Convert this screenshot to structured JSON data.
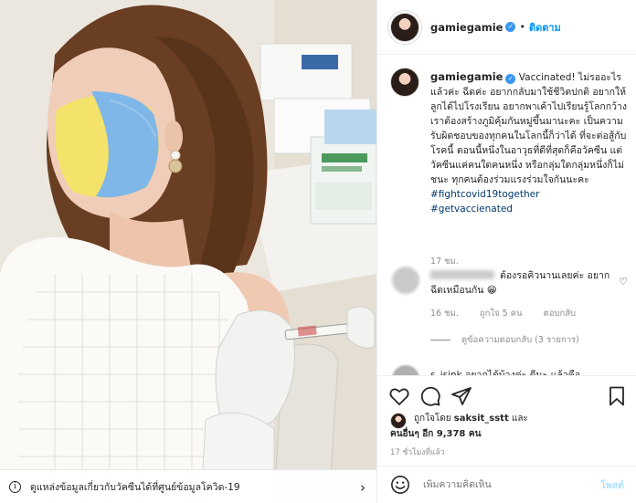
{
  "photo": {
    "info_text": "ดูแหล่งข้อมูลเกี่ยวกับวัคซีนได้ที่ศูนย์ข้อมูลโควิด-19"
  },
  "header": {
    "username": "gamiegamie",
    "follow_label": "ติดตาม"
  },
  "caption": {
    "username": "gamiegamie",
    "text": "Vaccinated! ไม่รออะไรแล้วค่ะ ฉีดค่ะ อยากกลับมาใช้ชีวิตปกติ อยากให้ลูกได้ไปโรงเรียน อยากพาเค้าไปเรียนรู้โลกกว้าง เราต้องสร้างภูมิคุ้มกันหมู่ขึ้นมานะคะ เป็นความรับผิดชอบของทุกคนในโลกนี้ก็ว่าได้ ที่จะต่อสู้กับโรคนี้ ตอนนี้หนึ่งในอาวุธที่ดีที่สุดก็คือวัคซีน แต่วัคซีนแค่คนใดคนหนึ่ง หรือกลุ่มใดกลุ่มหนึ่งก็ไม่ชนะ ทุกคนต้องร่วมแรงร่วมใจกันนะคะ",
    "hashtags": [
      "#fightcovid19together",
      "#getvaccienated"
    ],
    "time": "17 ชม."
  },
  "reply": {
    "text": "ต้องรอคิวนานเลยค่ะ อยากฉีดเหมือนกัน 😁",
    "time": "16 ชม.",
    "likes": "ถูกใจ 5 คน",
    "reply_label": "ตอบกลับ",
    "view_replies": "ดูข้อความตอบกลับ (3 รายการ)"
  },
  "next_comment": {
    "text": "s_isink อยากได้บ้างค่ะ ดีนะ แล้วคือ"
  },
  "likes": {
    "line1_prefix": "ถูกใจโดย",
    "line1_user": "saksit_sstt",
    "line1_suffix": "และ",
    "line2": "คนอื่นๆ อีก 9,378 คน"
  },
  "post_time": "17 ชั่วโมงที่แล้ว",
  "add_comment": {
    "placeholder": "เพิ่มความคิดเห็น",
    "post_label": "โพสต์"
  },
  "icons": {
    "verified": "verified-badge-icon",
    "heart": "heart-icon",
    "comment": "comment-icon",
    "share": "share-icon",
    "save": "bookmark-icon",
    "emoji": "emoji-icon",
    "info": "info-icon"
  },
  "colors": {
    "link_blue": "#0095f6",
    "verified_blue": "#3897f0",
    "muted_gray": "#8e8e8e",
    "hashtag_blue": "#00376b"
  }
}
